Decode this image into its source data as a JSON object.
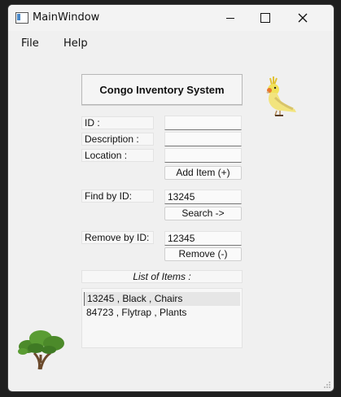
{
  "window": {
    "title": "MainWindow"
  },
  "menu": {
    "file": "File",
    "help": "Help"
  },
  "header": {
    "title": "Congo Inventory System"
  },
  "form": {
    "id_label": "ID :",
    "description_label": "Description :",
    "location_label": "Location :",
    "id_value": "",
    "description_value": "",
    "location_value": "",
    "add_button": "Add Item (+)",
    "find_label": "Find by ID:",
    "find_value": "13245",
    "search_button": "Search ->",
    "remove_label": "Remove by ID:",
    "remove_value": "12345",
    "remove_button": "Remove (-)"
  },
  "list": {
    "title": "List of Items :",
    "items": [
      "13245 , Black , Chairs",
      "84723 , Flytrap , Plants"
    ]
  },
  "icons": {
    "app": "window-app-icon",
    "minimize": "minimize-icon",
    "maximize": "maximize-icon",
    "close": "close-icon",
    "bird": "cockatiel-icon",
    "tree": "tree-icon"
  }
}
